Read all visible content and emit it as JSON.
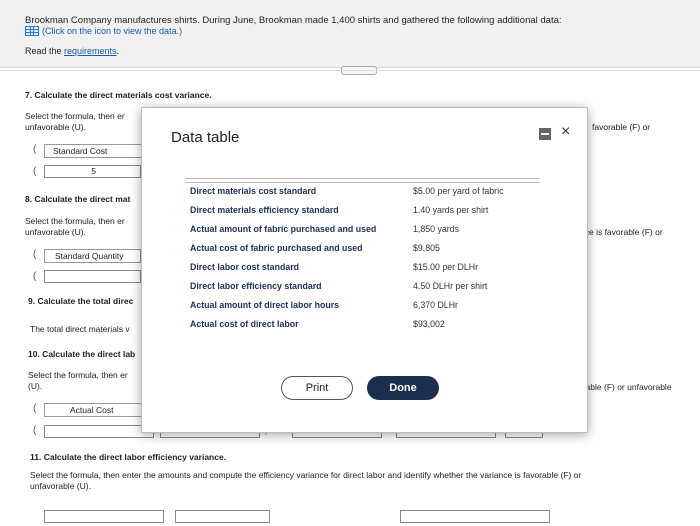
{
  "header": {
    "intro": "Brookman Company manufactures shirts. During June, Brookman made 1,400 shirts and gathered the following additional data:",
    "click_text": "(Click on the icon to view the data.)",
    "read_prefix": "Read the ",
    "read_link": "requirements",
    "read_suffix": ".",
    "dots": "....."
  },
  "q7": {
    "title": "7. Calculate the direct materials cost variance.",
    "instr1": "Select the formula, then er",
    "instr2": "unfavorable (U).",
    "right_text": "favorable (F) or",
    "label": "Standard Cost",
    "value": "5",
    "paren1": "(",
    "paren2": "("
  },
  "q8": {
    "title": "8. Calculate the direct mat",
    "instr1": "Select the formula, then er",
    "instr2": "unfavorable (U).",
    "right_text": "nce is favorable (F) or",
    "label": "Standard Quantity",
    "paren1": "(",
    "paren2": "("
  },
  "q9": {
    "title": "9. Calculate the total direc",
    "text": "The total direct materials v"
  },
  "q10": {
    "title": "10. Calculate the direct lab",
    "instr1": "Select the formula, then er",
    "instr2": "(U).",
    "right_text": "brable (F) or unfavorable",
    "label": "Actual Cost",
    "paren1": "(",
    "paren2": "(",
    "close_paren": ")",
    "times": "×",
    "equals": "="
  },
  "q11": {
    "title": "11. Calculate the direct labor efficiency variance.",
    "instr1": "Select the formula, then enter the amounts and compute the efficiency variance for direct labor and identify whether the variance is favorable (F) or",
    "instr2": "unfavorable (U)."
  },
  "modal": {
    "title": "Data table",
    "close": "×",
    "print": "Print",
    "done": "Done",
    "rows": [
      {
        "label": "Direct materials cost standard",
        "value": "$5.00 per yard of fabric"
      },
      {
        "label": "Direct materials efficiency standard",
        "value": "1.40 yards per shirt"
      },
      {
        "label": "Actual amount of fabric purchased and used",
        "value": "1,850 yards"
      },
      {
        "label": "Actual cost of fabric purchased and used",
        "value": "$9,805"
      },
      {
        "label": "Direct labor cost standard",
        "value": "$15.00 per DLHr"
      },
      {
        "label": "Direct labor efficiency standard",
        "value": "4.50 DLHr per shirt"
      },
      {
        "label": "Actual amount of direct labor hours",
        "value": "6,370 DLHr"
      },
      {
        "label": "Actual cost of direct labor",
        "value": "$93,002"
      }
    ]
  },
  "colors": {
    "accent": "#1a5ca8",
    "done_button": "#1c2f4e",
    "table_label": "#1f2f55"
  },
  "icons": [
    "data-grid-icon",
    "minimize-icon",
    "close-icon"
  ]
}
